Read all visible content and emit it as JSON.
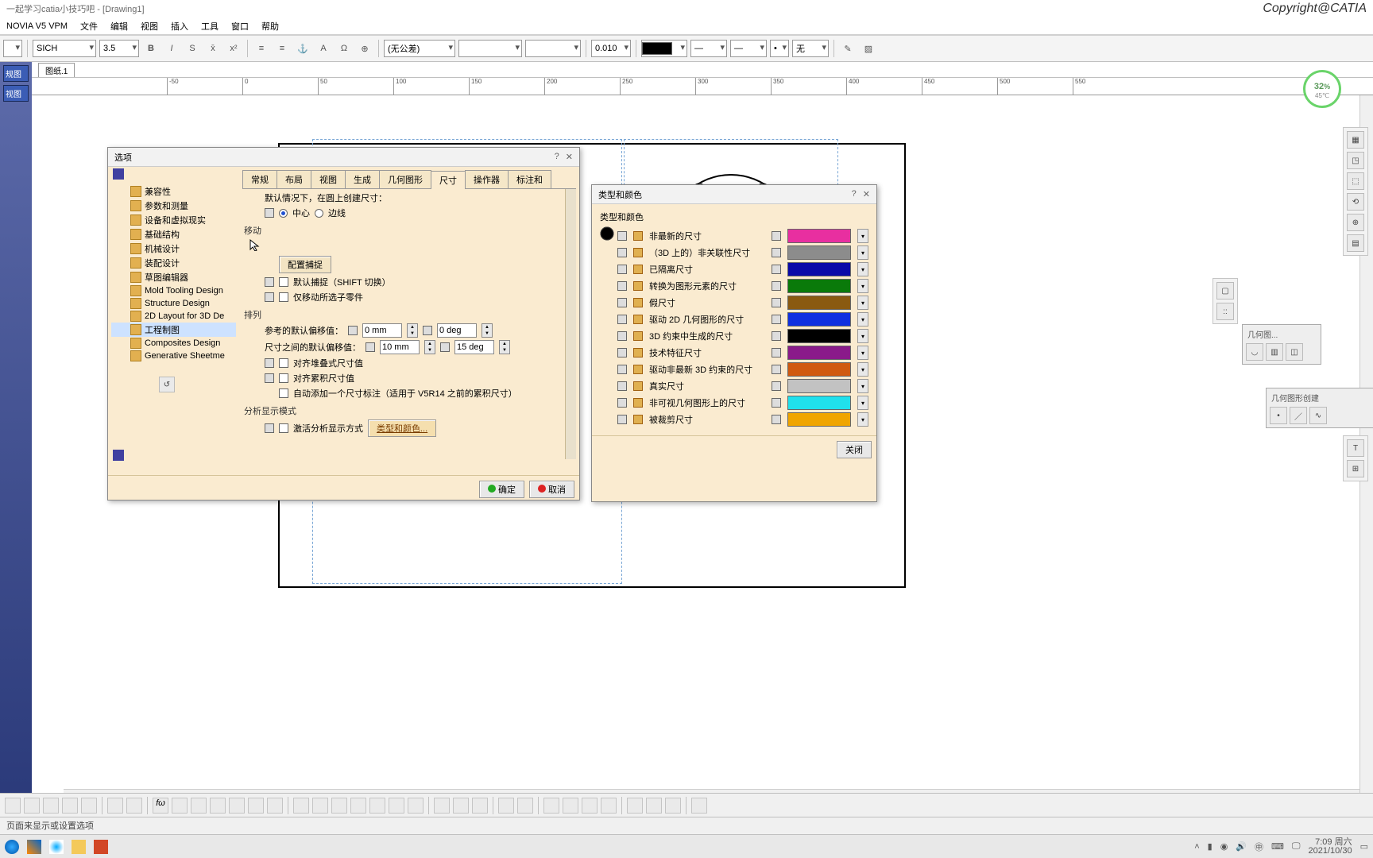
{
  "title": "一起学习catia小技巧吧 - [Drawing1]",
  "copyright": "Copyright@CATIA",
  "menu": [
    "NOVIA V5 VPM",
    "文件",
    "编辑",
    "视图",
    "插入",
    "工具",
    "窗口",
    "帮助"
  ],
  "toolbar": {
    "font": "SICH",
    "size": "3.5",
    "tolerance": "(无公差)",
    "precision": "0.010",
    "linetype_label": "无"
  },
  "left_panel": {
    "items": [
      "规图",
      "视图"
    ]
  },
  "sheet_tab": "图纸.1",
  "ruler_ticks": [
    "-50",
    "0",
    "50",
    "100",
    "150",
    "200",
    "250",
    "300",
    "350",
    "400",
    "450",
    "500",
    "550"
  ],
  "battery": {
    "pct": "32",
    "unit": "%",
    "temp": "45℃"
  },
  "options_dialog": {
    "title": "选项",
    "tree": [
      "兼容性",
      "参数和测量",
      "设备和虚拟现实",
      "基础结构",
      "机械设计",
      "装配设计",
      "草图编辑器",
      "Mold Tooling Design",
      "Structure Design",
      "2D Layout for 3D De",
      "工程制图",
      "Composites Design",
      "Generative Sheetme"
    ],
    "tree_hl_index": 10,
    "tabs": [
      "常规",
      "布局",
      "视图",
      "生成",
      "几何图形",
      "尺寸",
      "操作器",
      "标注和"
    ],
    "active_tab_index": 5,
    "note": "默认情况下，在圆上创建尺寸：",
    "center": "中心",
    "edge": "边线",
    "move_section": "移动",
    "cfg_snap": "配置捕捉",
    "default_snap": "默认捕捉（SHIFT 切换）",
    "only_move_sel": "仅移动所选子零件",
    "arrange_section": "排列",
    "ref_offset": "参考的默认偏移值：",
    "ref_offset_mm": "0 mm",
    "ref_offset_deg": "0 deg",
    "inter_offset": "尺寸之间的默认偏移值：",
    "inter_offset_mm": "10 mm",
    "inter_offset_deg": "15 deg",
    "align_stacked": "对齐堆叠式尺寸值",
    "align_cum": "对齐累积尺寸值",
    "auto_add": "自动添加一个尺寸标注（适用于 V5R14 之前的累积尺寸）",
    "disp_section": "分析显示模式",
    "activate_disp": "激活分析显示方式",
    "types_colors_btn": "类型和颜色...",
    "ok": "确定",
    "cancel": "取消"
  },
  "types_dialog": {
    "title": "类型和颜色",
    "group": "类型和颜色",
    "rows": [
      {
        "label": "非最新的尺寸",
        "color": "#e82fa0"
      },
      {
        "label": "（3D 上的）非关联性尺寸",
        "color": "#8c8c8c"
      },
      {
        "label": "已隔离尺寸",
        "color": "#0a0aa8"
      },
      {
        "label": "转换为图形元素的尺寸",
        "color": "#0a7a0a"
      },
      {
        "label": "假尺寸",
        "color": "#8a5a10"
      },
      {
        "label": "驱动 2D 几何图形的尺寸",
        "color": "#1030e0"
      },
      {
        "label": "3D 约束中生成的尺寸",
        "color": "#000000"
      },
      {
        "label": "技术特征尺寸",
        "color": "#8a1a8a"
      },
      {
        "label": "驱动非最新 3D 约束的尺寸",
        "color": "#d05a10"
      },
      {
        "label": "真实尺寸",
        "color": "#c2c2c2"
      },
      {
        "label": "非可视几何图形上的尺寸",
        "color": "#20e0ec"
      },
      {
        "label": "被裁剪尺寸",
        "color": "#f0a500"
      }
    ],
    "close": "关闭"
  },
  "panel_geo1": "几何图...",
  "panel_geo2": "几何图形创建",
  "status": "页面来显示或设置选项",
  "clock": {
    "time": "7:09 周六",
    "date": "2021/10/30"
  }
}
